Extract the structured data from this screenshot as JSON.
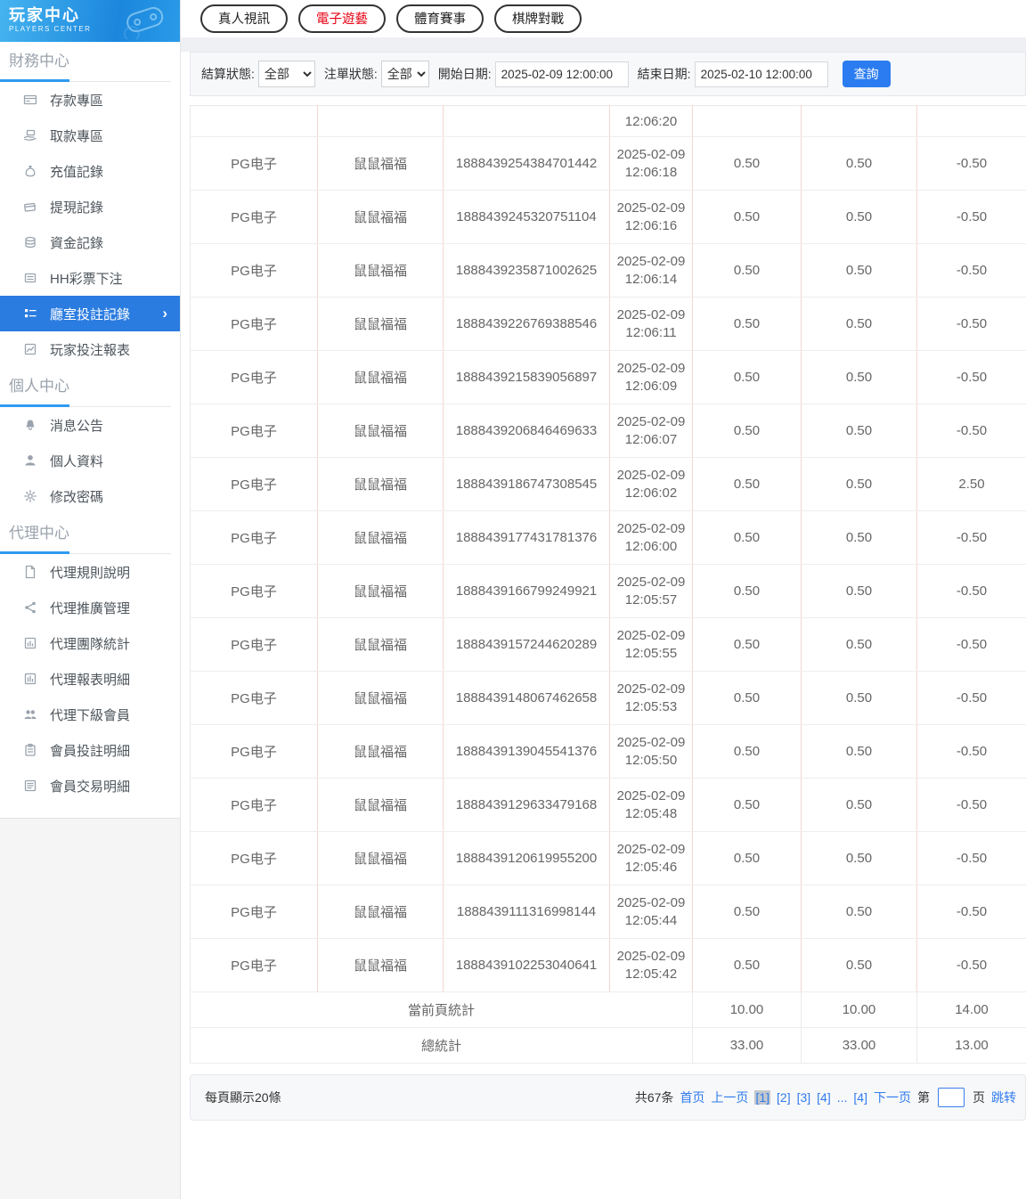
{
  "app": {
    "title": "玩家中心",
    "subtitle": "PLAYERS CENTER"
  },
  "sidebar": {
    "sections": [
      {
        "title": "財務中心",
        "items": [
          {
            "label": "存款專區"
          },
          {
            "label": "取款專區"
          },
          {
            "label": "充值記錄"
          },
          {
            "label": "提現記錄"
          },
          {
            "label": "資金記錄"
          },
          {
            "label": "HH彩票下注"
          },
          {
            "label": "廳室投註記錄",
            "active": true
          },
          {
            "label": "玩家投注報表"
          }
        ]
      },
      {
        "title": "個人中心",
        "items": [
          {
            "label": "消息公告"
          },
          {
            "label": "個人資料"
          },
          {
            "label": "修改密碼"
          }
        ]
      },
      {
        "title": "代理中心",
        "items": [
          {
            "label": "代理規則說明"
          },
          {
            "label": "代理推廣管理"
          },
          {
            "label": "代理團隊統計"
          },
          {
            "label": "代理報表明細"
          },
          {
            "label": "代理下級會員"
          },
          {
            "label": "會員投註明細"
          },
          {
            "label": "會員交易明細"
          }
        ]
      }
    ],
    "active_chevron": "›"
  },
  "topbar": {
    "categories": [
      {
        "label": "真人視訊",
        "current": false
      },
      {
        "label": "電子遊藝",
        "current": true
      },
      {
        "label": "體育賽事",
        "current": false
      },
      {
        "label": "棋牌對戰",
        "current": false
      }
    ]
  },
  "filters": {
    "settle_status_label": "結算狀態:",
    "settle_status_value": "全部",
    "order_status_label": "注單狀態:",
    "order_status_value": "全部",
    "start_date_label": "開始日期:",
    "start_date_value": "2025-02-09 12:00:00",
    "end_date_label": "結束日期:",
    "end_date_value": "2025-02-10 12:00:00",
    "search_label": "查詢"
  },
  "table": {
    "partial_row_time": "12:06:20",
    "rows": [
      {
        "provider": "PG电子",
        "game": "鼠鼠福福",
        "order_no": "1888439254384701442",
        "date": "2025-02-09",
        "time": "12:06:18",
        "bet": "0.50",
        "valid_bet": "0.50",
        "win_loss": "-0.50"
      },
      {
        "provider": "PG电子",
        "game": "鼠鼠福福",
        "order_no": "1888439245320751104",
        "date": "2025-02-09",
        "time": "12:06:16",
        "bet": "0.50",
        "valid_bet": "0.50",
        "win_loss": "-0.50"
      },
      {
        "provider": "PG电子",
        "game": "鼠鼠福福",
        "order_no": "1888439235871002625",
        "date": "2025-02-09",
        "time": "12:06:14",
        "bet": "0.50",
        "valid_bet": "0.50",
        "win_loss": "-0.50"
      },
      {
        "provider": "PG电子",
        "game": "鼠鼠福福",
        "order_no": "1888439226769388546",
        "date": "2025-02-09",
        "time": "12:06:11",
        "bet": "0.50",
        "valid_bet": "0.50",
        "win_loss": "-0.50"
      },
      {
        "provider": "PG电子",
        "game": "鼠鼠福福",
        "order_no": "1888439215839056897",
        "date": "2025-02-09",
        "time": "12:06:09",
        "bet": "0.50",
        "valid_bet": "0.50",
        "win_loss": "-0.50"
      },
      {
        "provider": "PG电子",
        "game": "鼠鼠福福",
        "order_no": "1888439206846469633",
        "date": "2025-02-09",
        "time": "12:06:07",
        "bet": "0.50",
        "valid_bet": "0.50",
        "win_loss": "-0.50"
      },
      {
        "provider": "PG电子",
        "game": "鼠鼠福福",
        "order_no": "1888439186747308545",
        "date": "2025-02-09",
        "time": "12:06:02",
        "bet": "0.50",
        "valid_bet": "0.50",
        "win_loss": "2.50"
      },
      {
        "provider": "PG电子",
        "game": "鼠鼠福福",
        "order_no": "1888439177431781376",
        "date": "2025-02-09",
        "time": "12:06:00",
        "bet": "0.50",
        "valid_bet": "0.50",
        "win_loss": "-0.50"
      },
      {
        "provider": "PG电子",
        "game": "鼠鼠福福",
        "order_no": "1888439166799249921",
        "date": "2025-02-09",
        "time": "12:05:57",
        "bet": "0.50",
        "valid_bet": "0.50",
        "win_loss": "-0.50"
      },
      {
        "provider": "PG电子",
        "game": "鼠鼠福福",
        "order_no": "1888439157244620289",
        "date": "2025-02-09",
        "time": "12:05:55",
        "bet": "0.50",
        "valid_bet": "0.50",
        "win_loss": "-0.50"
      },
      {
        "provider": "PG电子",
        "game": "鼠鼠福福",
        "order_no": "1888439148067462658",
        "date": "2025-02-09",
        "time": "12:05:53",
        "bet": "0.50",
        "valid_bet": "0.50",
        "win_loss": "-0.50"
      },
      {
        "provider": "PG电子",
        "game": "鼠鼠福福",
        "order_no": "1888439139045541376",
        "date": "2025-02-09",
        "time": "12:05:50",
        "bet": "0.50",
        "valid_bet": "0.50",
        "win_loss": "-0.50"
      },
      {
        "provider": "PG电子",
        "game": "鼠鼠福福",
        "order_no": "1888439129633479168",
        "date": "2025-02-09",
        "time": "12:05:48",
        "bet": "0.50",
        "valid_bet": "0.50",
        "win_loss": "-0.50"
      },
      {
        "provider": "PG电子",
        "game": "鼠鼠福福",
        "order_no": "1888439120619955200",
        "date": "2025-02-09",
        "time": "12:05:46",
        "bet": "0.50",
        "valid_bet": "0.50",
        "win_loss": "-0.50"
      },
      {
        "provider": "PG电子",
        "game": "鼠鼠福福",
        "order_no": "1888439111316998144",
        "date": "2025-02-09",
        "time": "12:05:44",
        "bet": "0.50",
        "valid_bet": "0.50",
        "win_loss": "-0.50"
      },
      {
        "provider": "PG电子",
        "game": "鼠鼠福福",
        "order_no": "1888439102253040641",
        "date": "2025-02-09",
        "time": "12:05:42",
        "bet": "0.50",
        "valid_bet": "0.50",
        "win_loss": "-0.50"
      }
    ],
    "page_summary": {
      "label": "當前頁統計",
      "bet": "10.00",
      "valid_bet": "10.00",
      "win_loss": "14.00"
    },
    "total_summary": {
      "label": "總統計",
      "bet": "33.00",
      "valid_bet": "33.00",
      "win_loss": "13.00"
    }
  },
  "pagination": {
    "per_page": "每頁顯示20條",
    "total": "共67条",
    "first": "首页",
    "prev": "上一页",
    "pages": [
      {
        "label": "[1]",
        "current": true
      },
      {
        "label": "[2]"
      },
      {
        "label": "[3]"
      },
      {
        "label": "[4]"
      },
      {
        "label": "..."
      },
      {
        "label": "[4]"
      }
    ],
    "next": "下一页",
    "jump_pre": "第",
    "jump_input_value": "",
    "jump_post": "页",
    "jump_go": "跳转"
  },
  "colors": {
    "accent_blue": "#2b7ce0",
    "link_blue": "#2f7bed",
    "active_category_red": "#e60012",
    "table_vertical_border": "#f2d6d1",
    "current_page_bg": "#c2c7cd"
  }
}
